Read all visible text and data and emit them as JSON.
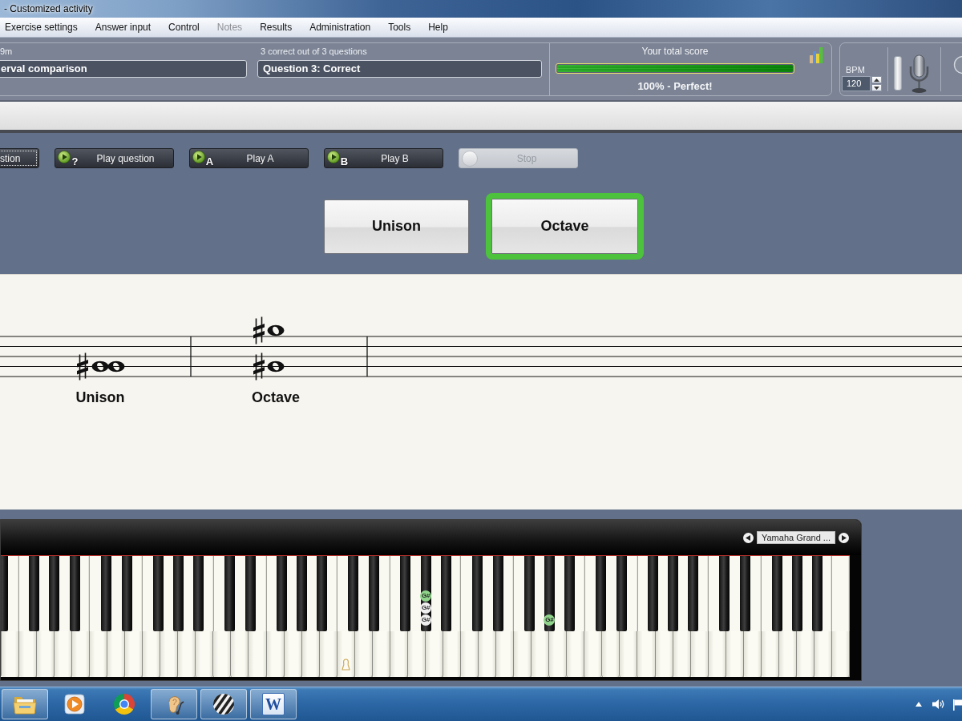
{
  "window": {
    "title": "- Customized activity"
  },
  "menu": [
    {
      "label": "Exercise settings",
      "disabled": false
    },
    {
      "label": "Answer input",
      "disabled": false
    },
    {
      "label": "Control",
      "disabled": false
    },
    {
      "label": "Notes",
      "disabled": true
    },
    {
      "label": "Results",
      "disabled": false
    },
    {
      "label": "Administration",
      "disabled": false
    },
    {
      "label": "Tools",
      "disabled": false
    },
    {
      "label": "Help",
      "disabled": false
    }
  ],
  "status": {
    "exercise": {
      "label": "9m",
      "value": "erval comparison"
    },
    "progress": {
      "label": "3 correct out of 3 questions",
      "value": "Question 3: Correct"
    },
    "score": {
      "title": "Your total score",
      "level": 1,
      "reading": "100% - Perfect!"
    },
    "bpm": {
      "label": "BPM",
      "value": "120"
    }
  },
  "controls": [
    {
      "label": "stion",
      "kind": "plain",
      "focused": true,
      "disabled": false
    },
    {
      "label": "Play question",
      "kind": "play",
      "badge": "?",
      "focused": false,
      "disabled": false
    },
    {
      "label": "Play A",
      "kind": "play",
      "badge": "A",
      "focused": false,
      "disabled": false
    },
    {
      "label": "Play B",
      "kind": "play",
      "badge": "B",
      "focused": false,
      "disabled": false
    },
    {
      "label": "Stop",
      "kind": "stop",
      "focused": false,
      "disabled": true
    }
  ],
  "answers": [
    {
      "label": "Unison",
      "selected": false
    },
    {
      "label": "Octave",
      "selected": true
    }
  ],
  "staff": {
    "measures": [
      {
        "kind": "unison",
        "label": "Unison"
      },
      {
        "kind": "octave",
        "label": "Octave"
      }
    ]
  },
  "keyboard": {
    "instrument": "Yamaha Grand ...",
    "marked_keys": [
      {
        "markers": [
          {
            "label": "G#",
            "color": "#8fd48a"
          },
          {
            "label": "G#",
            "color": "#f0f0f0"
          },
          {
            "label": "G#",
            "color": "#f0f0f0"
          }
        ]
      },
      {
        "markers": [
          {
            "label": "G#",
            "color": "#8fd48a"
          }
        ]
      }
    ]
  },
  "taskbar": {
    "apps": [
      {
        "kind": "folder",
        "running": true
      },
      {
        "kind": "player",
        "running": false
      },
      {
        "kind": "ring",
        "running": false
      },
      {
        "kind": "ear",
        "running": true
      },
      {
        "kind": "stripes",
        "running": true
      },
      {
        "kind": "letter",
        "letter": "W",
        "running": true
      }
    ]
  }
}
